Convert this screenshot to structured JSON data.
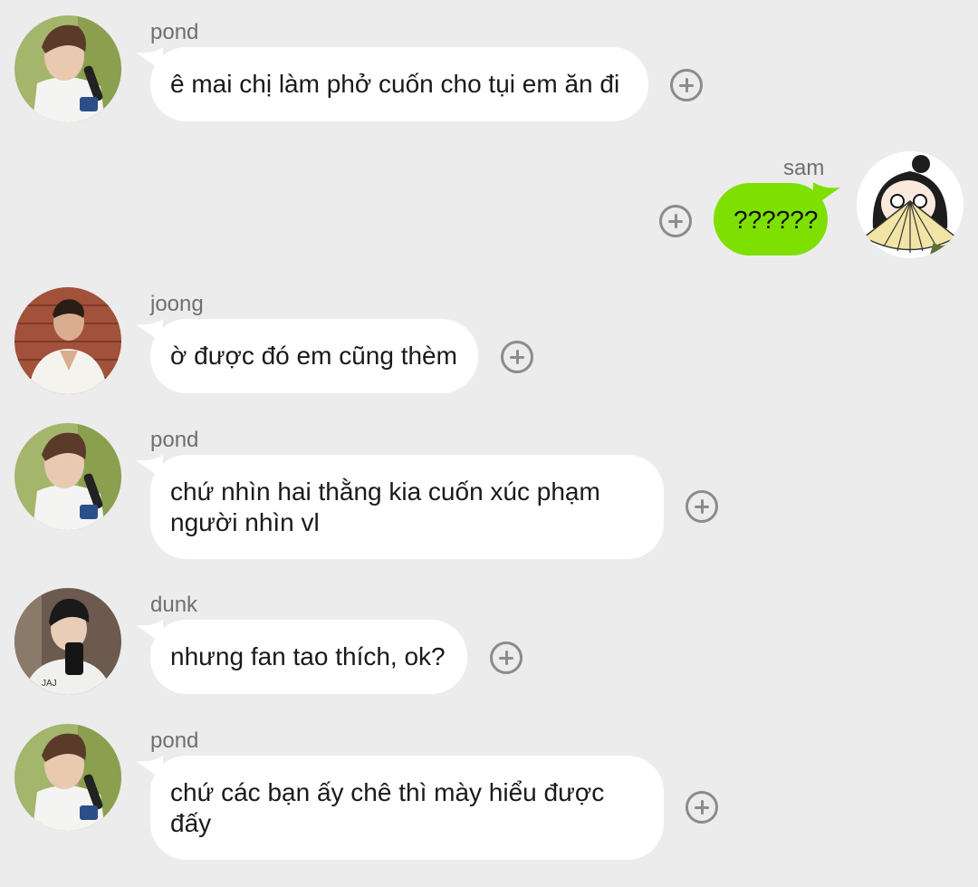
{
  "messages": [
    {
      "sender": "pond",
      "text": "ê mai chị làm phở cuốn cho tụi em ăn đi",
      "avatar": "pond-avatar",
      "side": "left"
    },
    {
      "sender": "sam",
      "text": "??????",
      "avatar": "sam-avatar",
      "side": "right"
    },
    {
      "sender": "joong",
      "text": "ờ được đó em cũng thèm",
      "avatar": "joong-avatar",
      "side": "left"
    },
    {
      "sender": "pond",
      "text": "chứ nhìn hai thằng kia cuốn xúc phạm người nhìn vl",
      "avatar": "pond-avatar",
      "side": "left"
    },
    {
      "sender": "dunk",
      "text": "nhưng fan tao thích, ok?",
      "avatar": "dunk-avatar",
      "side": "left"
    },
    {
      "sender": "pond",
      "text": "chứ các bạn ấy chê thì mày hiểu được đấy",
      "avatar": "pond-avatar",
      "side": "left"
    }
  ],
  "colors": {
    "background": "#ececec",
    "bubble_other": "#ffffff",
    "bubble_mine": "#7ee000",
    "react_icon": "#8b8b8b"
  },
  "icons": {
    "react": "plus-circle-icon"
  }
}
